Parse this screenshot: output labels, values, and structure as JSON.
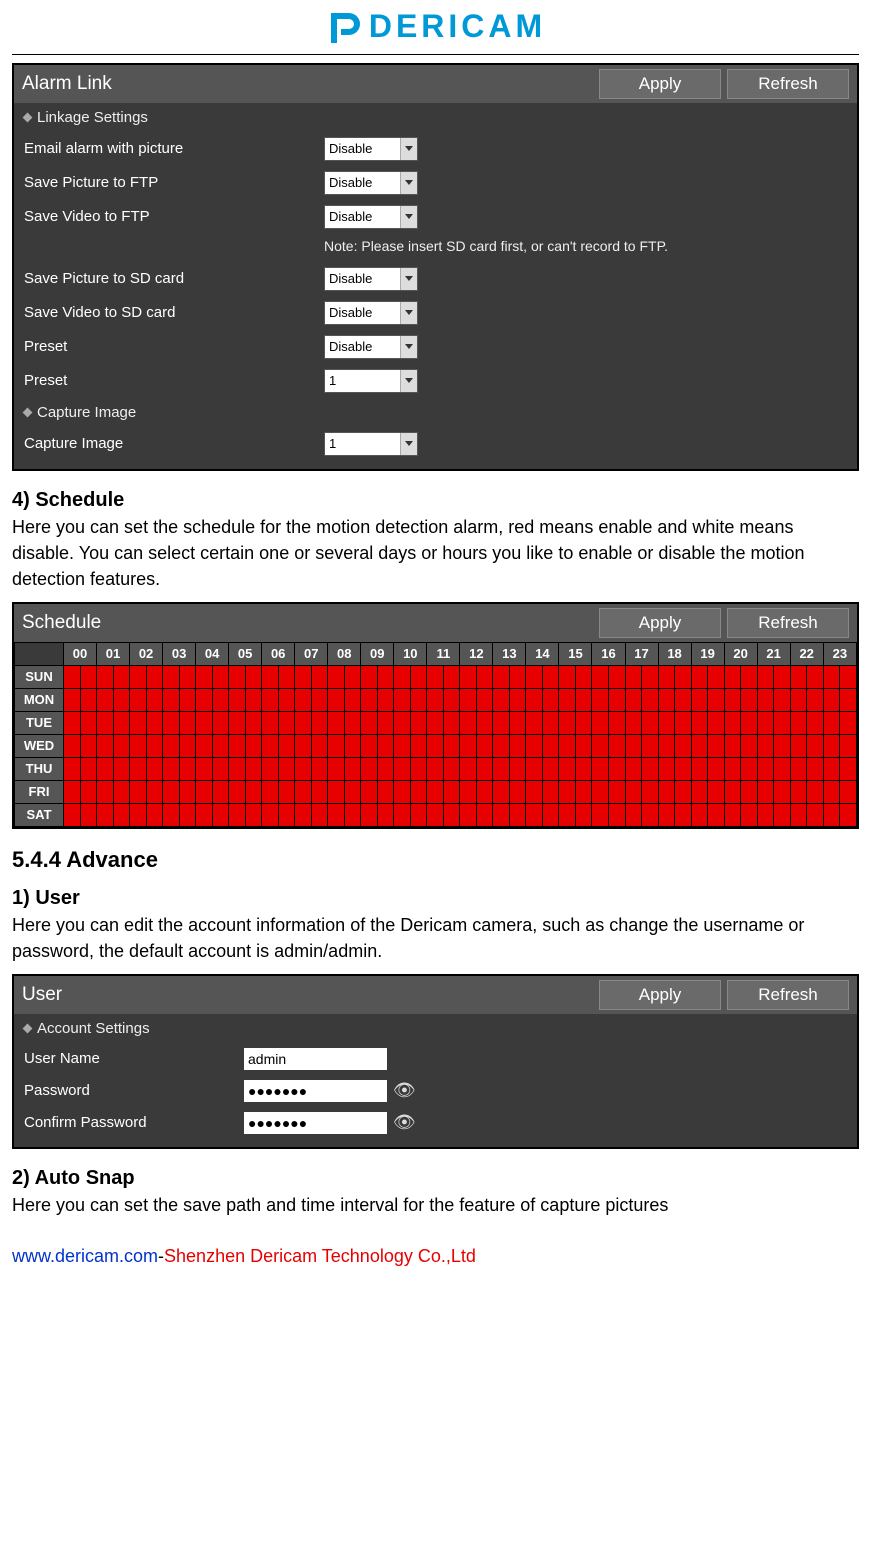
{
  "logo": {
    "text": "DERICAM"
  },
  "alarm": {
    "title": "Alarm Link",
    "apply": "Apply",
    "refresh": "Refresh",
    "linkage_header": "Linkage Settings",
    "capture_header": "Capture Image",
    "rows": {
      "email": {
        "label": "Email alarm with picture",
        "value": "Disable"
      },
      "pic_ftp": {
        "label": "Save Picture to FTP",
        "value": "Disable"
      },
      "vid_ftp": {
        "label": "Save Video to FTP",
        "value": "Disable"
      },
      "note": "Note: Please insert SD card first, or can't record to FTP.",
      "pic_sd": {
        "label": "Save Picture to SD card",
        "value": "Disable"
      },
      "vid_sd": {
        "label": "Save Video to SD card",
        "value": "Disable"
      },
      "preset1": {
        "label": "Preset",
        "value": "Disable"
      },
      "preset2": {
        "label": "Preset",
        "value": "1"
      },
      "capture": {
        "label": "Capture Image",
        "value": "1"
      }
    }
  },
  "doc": {
    "sched_h": "4) Schedule",
    "sched_p": "Here you can set the schedule for the motion detection alarm, red means enable and white means disable. You can select certain one or several days or hours you like to enable or disable the motion detection features.",
    "advance_h": "5.4.4 Advance",
    "user_h": "1) User",
    "user_p": "Here you can edit the account information of the Dericam camera, such as change the username or password, the default account is admin/admin.",
    "autosnap_h": "2) Auto Snap",
    "autosnap_p": "Here you can set the save path and time interval for the feature of capture pictures"
  },
  "schedule": {
    "title": "Schedule",
    "apply": "Apply",
    "refresh": "Refresh",
    "hours": [
      "00",
      "01",
      "02",
      "03",
      "04",
      "05",
      "06",
      "07",
      "08",
      "09",
      "10",
      "11",
      "12",
      "13",
      "14",
      "15",
      "16",
      "17",
      "18",
      "19",
      "20",
      "21",
      "22",
      "23"
    ],
    "days": [
      "SUN",
      "MON",
      "TUE",
      "WED",
      "THU",
      "FRI",
      "SAT"
    ]
  },
  "user": {
    "title": "User",
    "apply": "Apply",
    "refresh": "Refresh",
    "section": "Account Settings",
    "username_label": "User Name",
    "username_value": "admin",
    "password_label": "Password",
    "password_value": "●●●●●●●",
    "confirm_label": "Confirm Password",
    "confirm_value": "●●●●●●●"
  },
  "footer": {
    "url": "www.dericam.com",
    "dash": "-",
    "company": "Shenzhen Dericam Technology Co.,Ltd"
  }
}
